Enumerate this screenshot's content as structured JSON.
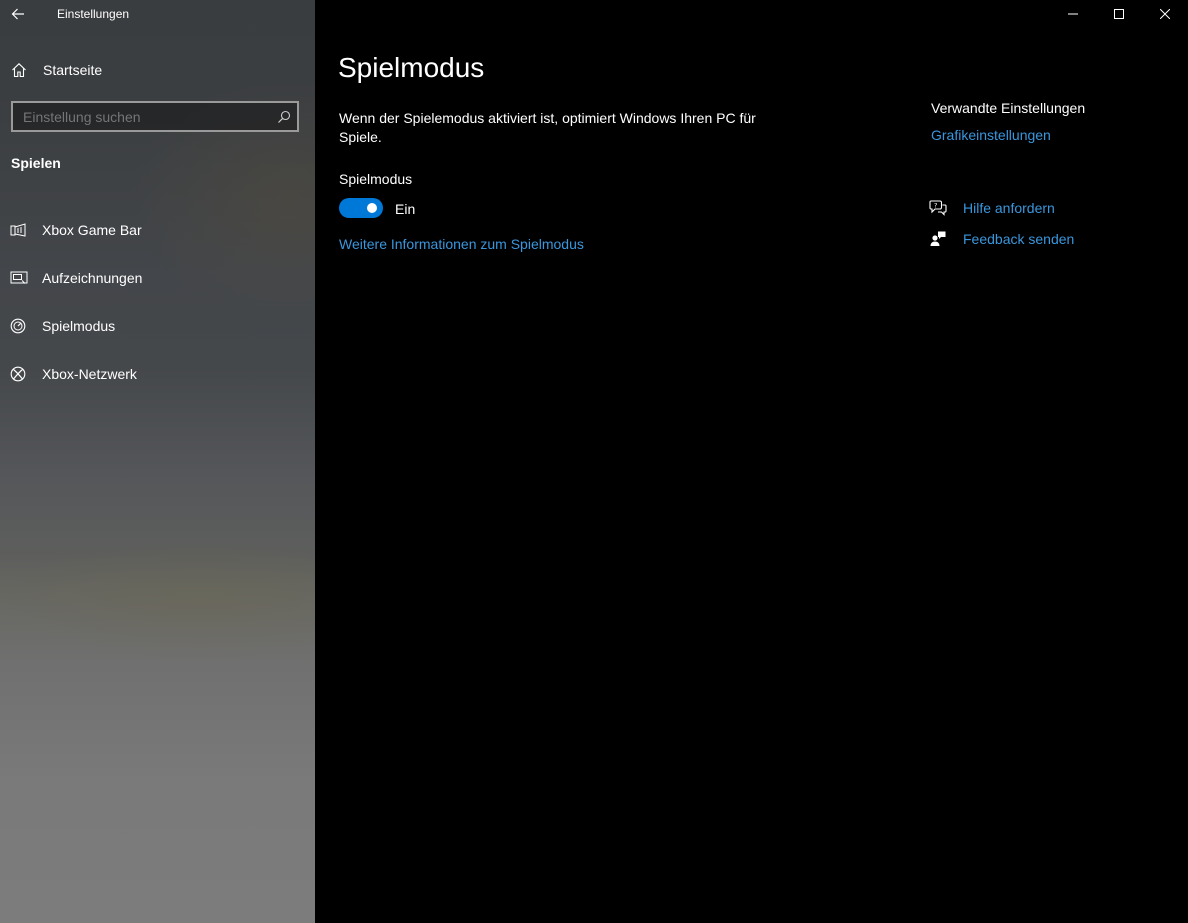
{
  "app": {
    "title": "Einstellungen"
  },
  "sidebar": {
    "home_label": "Startseite",
    "search_placeholder": "Einstellung suchen",
    "section_title": "Spielen",
    "items": [
      {
        "label": "Xbox Game Bar",
        "icon": "xbox-game-bar-icon"
      },
      {
        "label": "Aufzeichnungen",
        "icon": "captures-icon"
      },
      {
        "label": "Spielmodus",
        "icon": "game-mode-icon"
      },
      {
        "label": "Xbox-Netzwerk",
        "icon": "xbox-icon"
      }
    ]
  },
  "main": {
    "title": "Spielmodus",
    "description": "Wenn der Spielemodus aktiviert ist, optimiert Windows Ihren PC für Spiele.",
    "toggle": {
      "label": "Spielmodus",
      "state_label": "Ein",
      "on": true
    },
    "more_info_link": "Weitere Informationen zum Spielmodus"
  },
  "related": {
    "title": "Verwandte Einstellungen",
    "link": "Grafikeinstellungen"
  },
  "help": {
    "get_help": "Hilfe anfordern",
    "feedback": "Feedback senden"
  },
  "colors": {
    "accent": "#0078d7",
    "link": "#3a96dd",
    "background": "#000000"
  }
}
